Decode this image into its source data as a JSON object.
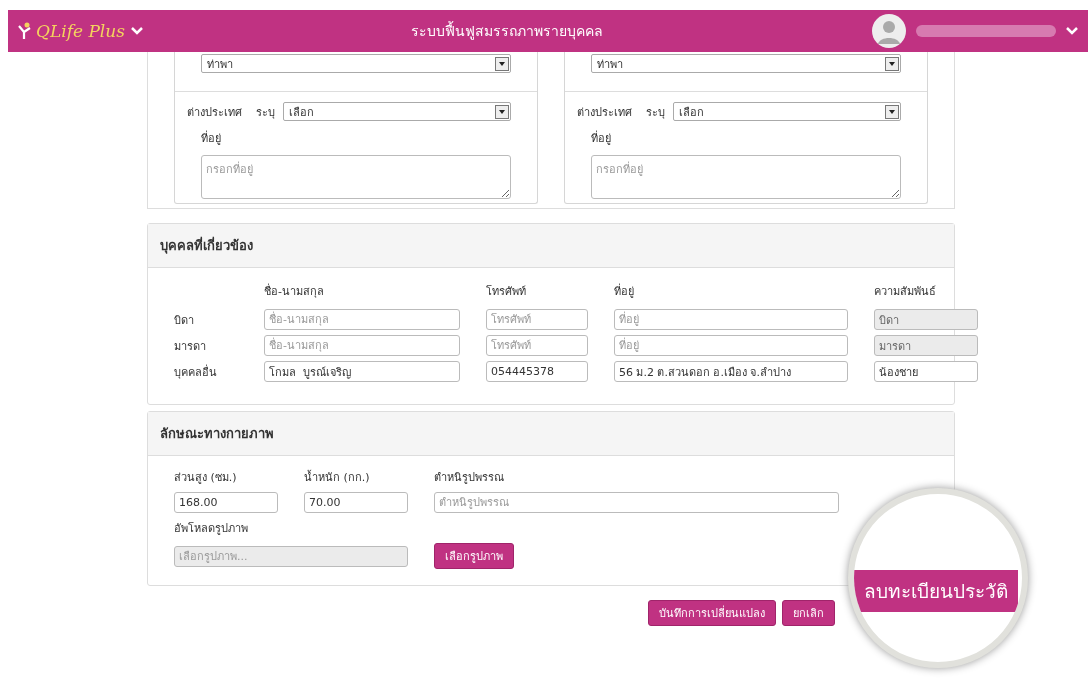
{
  "header": {
    "brand": "QLife Plus",
    "title": "ระบบฟื้นฟูสมรรถภาพรายบุคคล"
  },
  "address_columns": [
    {
      "subdistrict_select": "ท่าพา",
      "abroad_label": "ต่างประเทศ",
      "specify_label": "ระบุ",
      "country_select": "เลือก",
      "address_label": "ที่อยู่",
      "address_placeholder": "กรอกที่อยู่"
    },
    {
      "subdistrict_select": "ท่าพา",
      "abroad_label": "ต่างประเทศ",
      "specify_label": "ระบุ",
      "country_select": "เลือก",
      "address_label": "ที่อยู่",
      "address_placeholder": "กรอกที่อยู่"
    }
  ],
  "related_persons": {
    "title": "บุคคลที่เกี่ยวข้อง",
    "columns": [
      "ชื่อ-นามสกุล",
      "โทรศัพท์",
      "ที่อยู่",
      "ความสัมพันธ์"
    ],
    "rows": [
      {
        "label": "บิดา",
        "name": {
          "placeholder": "ชื่อ-นามสกุล"
        },
        "phone": {
          "placeholder": "โทรศัพท์"
        },
        "address": {
          "placeholder": "ที่อยู่"
        },
        "relationship": {
          "value": "บิดา",
          "disabled": true
        }
      },
      {
        "label": "มารดา",
        "name": {
          "placeholder": "ชื่อ-นามสกุล"
        },
        "phone": {
          "placeholder": "โทรศัพท์"
        },
        "address": {
          "placeholder": "ที่อยู่"
        },
        "relationship": {
          "value": "มารดา",
          "disabled": true
        }
      },
      {
        "label": "บุคคลอื่น",
        "name": {
          "value": "โกมล  บูรณ์เจริญ"
        },
        "phone": {
          "value": "054445378"
        },
        "address": {
          "value": "56 ม.2 ต.สวนดอก อ.เมือง จ.ลำปาง"
        },
        "relationship": {
          "value": "น้องชาย",
          "disabled": false
        }
      }
    ]
  },
  "physical": {
    "title": "ลักษณะทางกายภาพ",
    "height_label": "ส่วนสูง (ซม.)",
    "height_value": "168.00",
    "weight_label": "น้ำหนัก (กก.)",
    "weight_value": "70.00",
    "marks_label": "ตำหนิรูปพรรณ",
    "marks_placeholder": "ตำหนิรูปพรรณ",
    "upload_label": "อัพโหลดรูปภาพ",
    "upload_placeholder": "เลือกรูปภาพ...",
    "choose_button": "เลือกรูปภาพ"
  },
  "actions": {
    "buttons": [
      "บันทึกการเปลี่ยนแปลง",
      "ยกเลิก"
    ],
    "magnified_button": "ลบทะเบียนประวัติ"
  }
}
